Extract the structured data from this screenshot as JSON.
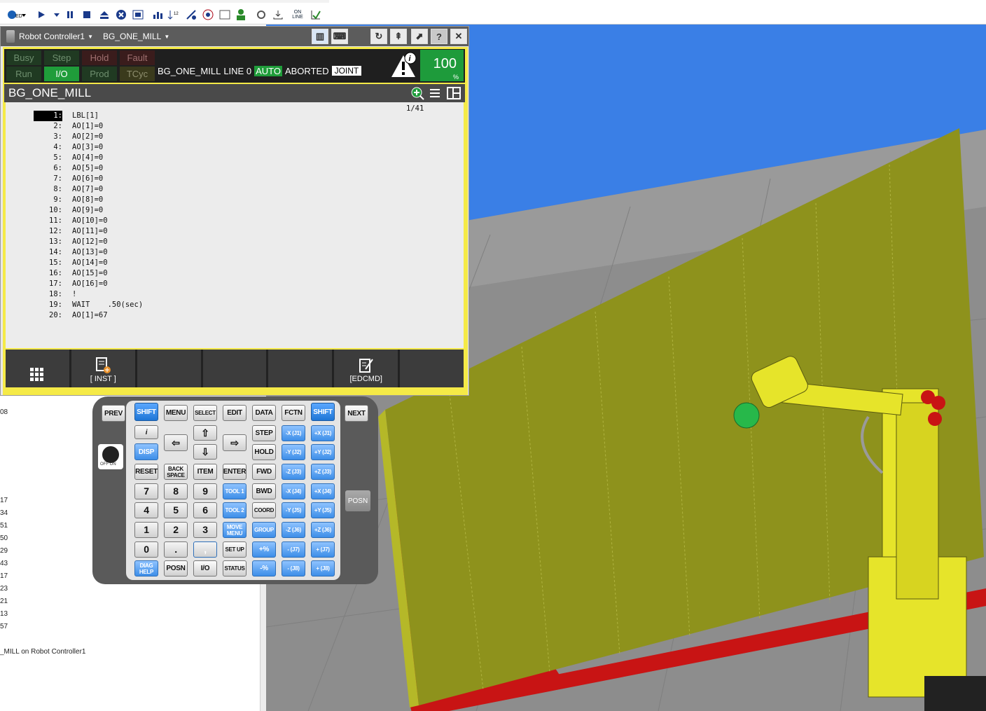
{
  "app": {
    "controller_label": "Robot Controller1",
    "program_dropdown": "BG_ONE_MILL"
  },
  "status": {
    "indicators": [
      {
        "label": "Busy",
        "active": false
      },
      {
        "label": "Step",
        "active": false
      },
      {
        "label": "Hold",
        "active": false
      },
      {
        "label": "Fault",
        "active": false
      },
      {
        "label": "Run",
        "active": false
      },
      {
        "label": "I/O",
        "active": true
      },
      {
        "label": "Prod",
        "active": false
      },
      {
        "label": "TCyc",
        "active": false
      }
    ],
    "program": "BG_ONE_MILL",
    "line_text": "LINE 0",
    "mode": "AUTO",
    "state": "ABORTED",
    "coord": "JOINT",
    "override_value": "100",
    "override_unit": "%"
  },
  "program_title": "BG_ONE_MILL",
  "listing": {
    "position": "1/41",
    "lines": [
      {
        "n": "1:",
        "code": "LBL[1]"
      },
      {
        "n": "2:",
        "code": "AO[1]=0"
      },
      {
        "n": "3:",
        "code": "AO[2]=0"
      },
      {
        "n": "4:",
        "code": "AO[3]=0"
      },
      {
        "n": "5:",
        "code": "AO[4]=0"
      },
      {
        "n": "6:",
        "code": "AO[5]=0"
      },
      {
        "n": "7:",
        "code": "AO[6]=0"
      },
      {
        "n": "8:",
        "code": "AO[7]=0"
      },
      {
        "n": "9:",
        "code": "AO[8]=0"
      },
      {
        "n": "10:",
        "code": "AO[9]=0"
      },
      {
        "n": "11:",
        "code": "AO[10]=0"
      },
      {
        "n": "12:",
        "code": "AO[11]=0"
      },
      {
        "n": "13:",
        "code": "AO[12]=0"
      },
      {
        "n": "14:",
        "code": "AO[13]=0"
      },
      {
        "n": "15:",
        "code": "AO[14]=0"
      },
      {
        "n": "16:",
        "code": "AO[15]=0"
      },
      {
        "n": "17:",
        "code": "AO[16]=0"
      },
      {
        "n": "18:",
        "code": "!"
      },
      {
        "n": "19:",
        "code": "WAIT    .50(sec)"
      },
      {
        "n": "20:",
        "code": "AO[1]=67"
      }
    ]
  },
  "fkeys": [
    "",
    "[ INST ]",
    "",
    "",
    "",
    "[EDCMD]",
    ""
  ],
  "keypad": {
    "row1": [
      "PREV",
      "SHIFT",
      "MENU",
      "SELECT",
      "EDIT",
      "DATA",
      "FCTN",
      "SHIFT",
      "NEXT"
    ],
    "info": "i",
    "disp": "DISP",
    "step": "STEP",
    "hold": "HOLD",
    "fwd": "FWD",
    "bwd": "BWD",
    "coord": "COORD",
    "group": "GROUP",
    "reset": "RESET",
    "backspace": "BACK SPACE",
    "item": "ITEM",
    "enter": "ENTER",
    "digits": [
      "7",
      "8",
      "9",
      "4",
      "5",
      "6",
      "1",
      "2",
      "3",
      "0",
      "."
    ],
    "comma": ",",
    "tool1": "TOOL 1",
    "tool2": "TOOL 2",
    "move_menu": "MOVE MENU",
    "setup": "SET UP",
    "diag_help": "DIAG HELP",
    "posn": "POSN",
    "io": "I/O",
    "status": "STATUS",
    "plus_pct": "+%",
    "minus_pct": "-%",
    "jog_minus": [
      "-X (J1)",
      "-Y (J2)",
      "-Z (J3)",
      "-X (J4)",
      "-Y (J5)",
      "-Z (J6)",
      "- (J7)",
      "- (J8)"
    ],
    "jog_plus": [
      "+X (J1)",
      "+Y (J2)",
      "+Z (J3)",
      "+X (J4)",
      "+Y (J5)",
      "+Z (J6)",
      "+ (J7)",
      "+ (J8)"
    ],
    "side_posn": "POSN",
    "onoff": "OFF  ON"
  },
  "left_panel": {
    "values": [
      "08",
      "17",
      "34",
      "51",
      "50",
      "29",
      "43",
      "17",
      "23",
      "21",
      "13",
      "57"
    ],
    "footer": "_MILL on Robot Controller1"
  },
  "toolbar": {
    "online_label": "ON LINE"
  },
  "colors": {
    "sky": "#3a7fe6",
    "floor": "#8d8d8d",
    "panel": "#8e921c",
    "robot": "#e6e42a",
    "accent": "#1e9b3b"
  }
}
